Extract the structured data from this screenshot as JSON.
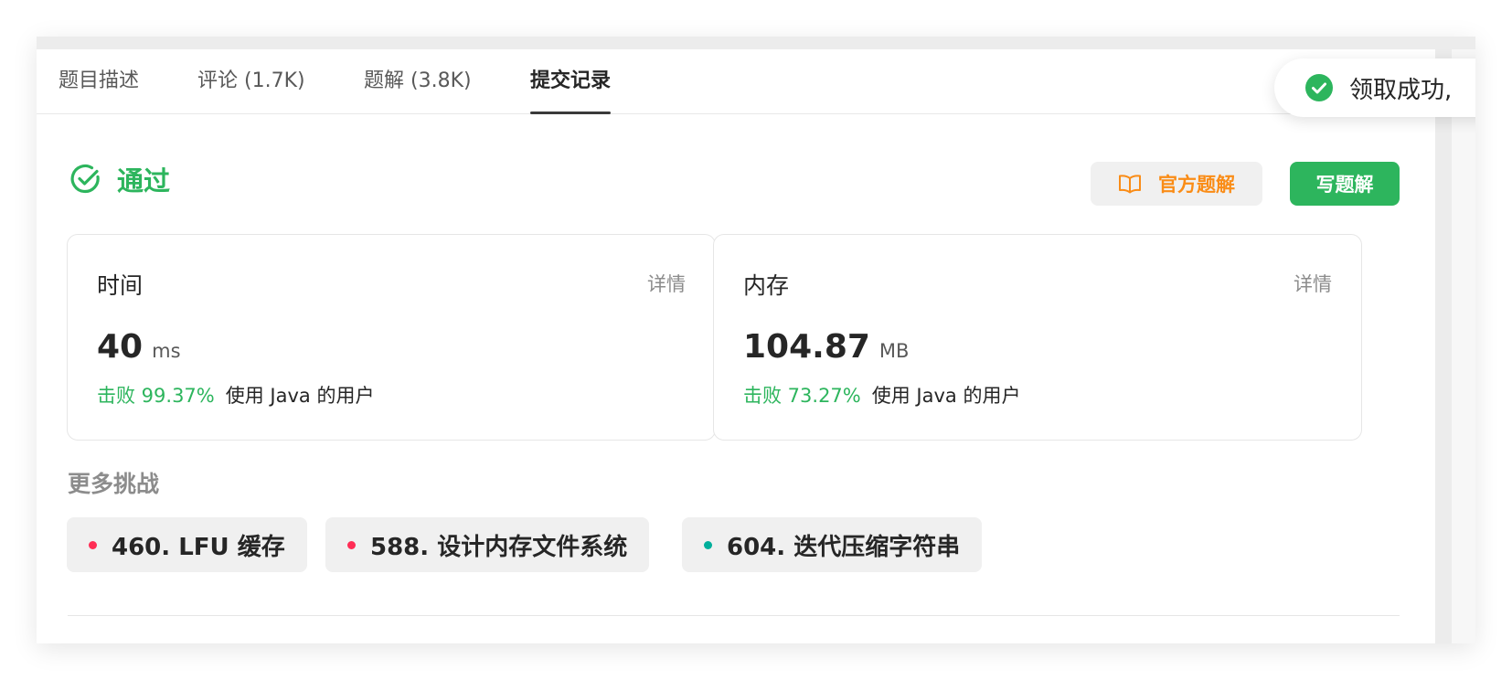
{
  "tabs": [
    {
      "label": "题目描述"
    },
    {
      "label": "评论 (1.7K)"
    },
    {
      "label": "题解 (3.8K)"
    },
    {
      "label": "提交记录"
    }
  ],
  "active_tab": "提交记录",
  "result": {
    "status": "通过",
    "status_color": "#2db55d",
    "official_solution_label": "官方题解",
    "write_solution_label": "写题解"
  },
  "stats": {
    "time": {
      "label": "时间",
      "detail": "详情",
      "value": "40",
      "unit": "ms",
      "beat": "击败 99.37%",
      "beat_desc": "使用 Java 的用户"
    },
    "memory": {
      "label": "内存",
      "detail": "详情",
      "value": "104.87",
      "unit": "MB",
      "beat": "击败 73.27%",
      "beat_desc": "使用 Java 的用户"
    }
  },
  "more": {
    "title": "更多挑战",
    "items": [
      {
        "label": "460. LFU 缓存",
        "difficulty_color": "#ff2d55"
      },
      {
        "label": "588. 设计内存文件系统",
        "difficulty_color": "#ff2d55"
      },
      {
        "label": "604. 迭代压缩字符串",
        "difficulty_color": "#00af9b"
      }
    ]
  },
  "toast": {
    "text": "领取成功,",
    "icon": "check-circle-icon"
  },
  "colors": {
    "accent_green": "#2db55d",
    "official_orange": "#fa8c16"
  }
}
